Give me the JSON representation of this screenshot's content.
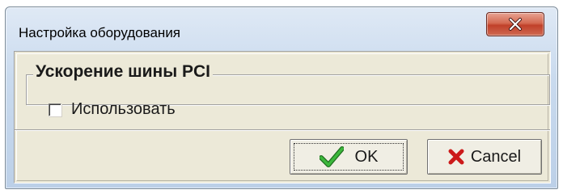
{
  "window": {
    "title": "Настройка оборудования"
  },
  "group": {
    "title": "Ускорение шины PCI",
    "checkbox_label": "Использовать",
    "checkbox_checked": false
  },
  "buttons": {
    "ok_label": "OK",
    "cancel_label": "Cancel"
  },
  "icons": {
    "close": "close-x-icon",
    "ok": "green-checkmark-icon",
    "cancel": "red-x-icon"
  },
  "colors": {
    "close_button": "#c9503a",
    "ok_check": "#2e9a2e",
    "cancel_x": "#cc1a1a",
    "dialog_face": "#ece9d8"
  }
}
